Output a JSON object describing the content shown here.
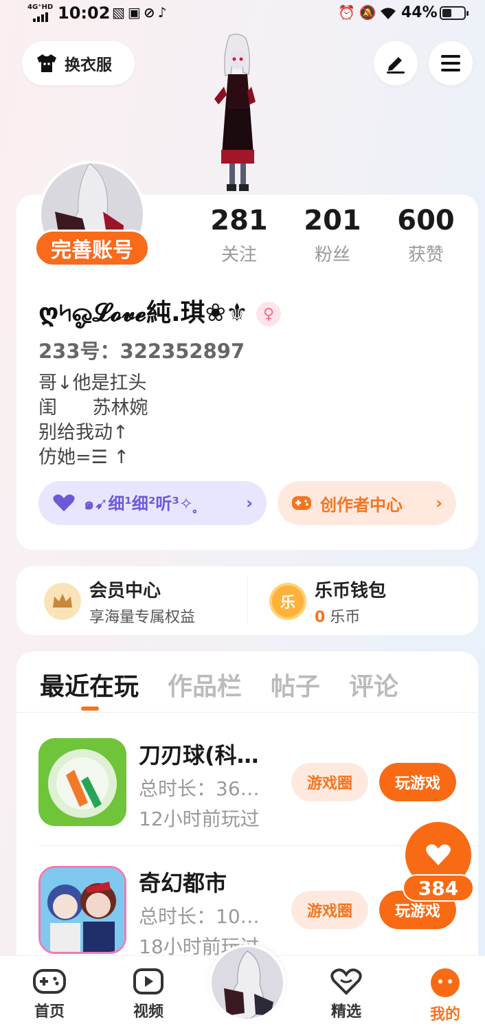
{
  "status_bar": {
    "network": "4G⁺HD",
    "time": "10:02",
    "battery": "44%",
    "battery_level": 0.44
  },
  "header": {
    "outfit_label": "换衣服"
  },
  "profile": {
    "complete_badge": "完善账号",
    "stats": [
      {
        "value": "281",
        "label": "关注"
      },
      {
        "value": "201",
        "label": "粉丝"
      },
      {
        "value": "600",
        "label": "获赞"
      }
    ],
    "nickname": "ღ৸ஓ𝓛𝓸𝓿𝓮純.琪❀⚜",
    "gender_symbol": "♀",
    "uid": "233号：322352897",
    "bio_lines": [
      "哥↓他是扛头",
      "闺      苏林婉",
      "别给我动↑",
      "仿她=☰ ↑"
    ],
    "tag_left": "๑➹细¹细²听³✧ ̥",
    "tag_right": "创作者中心"
  },
  "vip": {
    "title": "会员中心",
    "subtitle": "享海量专属权益"
  },
  "wallet": {
    "title": "乐币钱包",
    "amount": "0",
    "unit": "乐币",
    "coin_char": "乐"
  },
  "tabs": [
    "最近在玩",
    "作品栏",
    "帖子",
    "评论"
  ],
  "games": [
    {
      "name": "刀刃球(科…",
      "duration": "总时长：36…",
      "last_played": "12小时前玩过",
      "circle_label": "游戏圈",
      "play_label": "玩游戏"
    },
    {
      "name": "奇幻都市",
      "duration": "总时长：10…",
      "last_played": "18小时前玩过",
      "circle_label": "游戏圈",
      "play_label": "玩游戏"
    }
  ],
  "float_like_count": "384",
  "bottom_nav": [
    {
      "label": "首页"
    },
    {
      "label": "视频"
    },
    {
      "label": "精选"
    },
    {
      "label": "我的"
    }
  ],
  "colors": {
    "accent": "#f86b14",
    "purple_tag": "#6a5ad8"
  }
}
